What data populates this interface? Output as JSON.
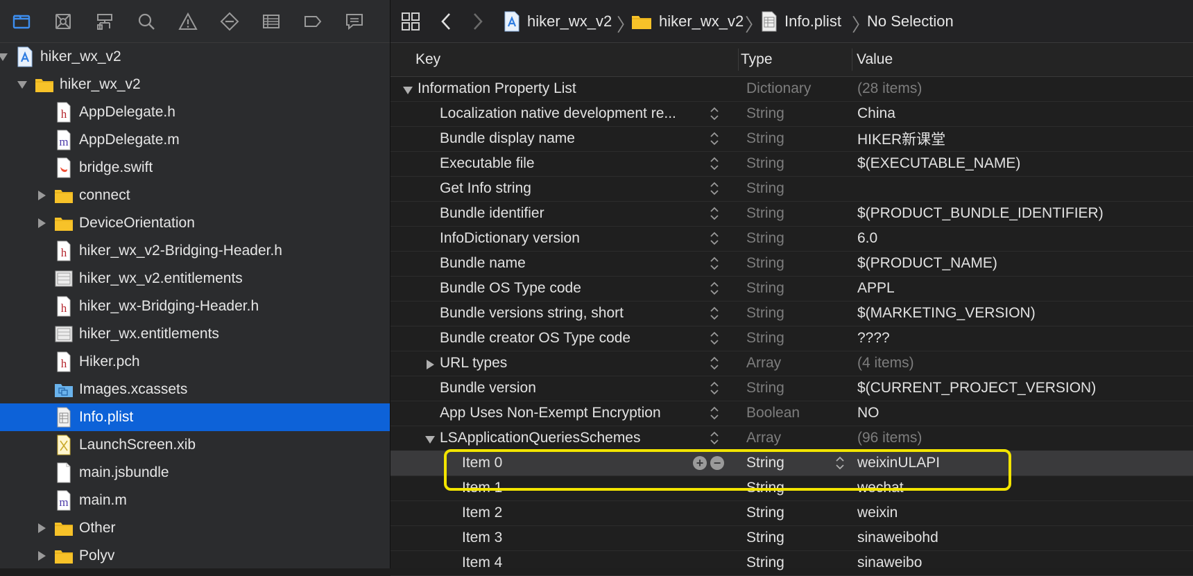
{
  "navigator": {
    "toolbar_icons": [
      "folder-icon",
      "source-control-icon",
      "hierarchy-icon",
      "search-icon",
      "warning-icon",
      "test-icon",
      "debug-icon",
      "breakpoint-icon",
      "report-icon"
    ],
    "items": [
      {
        "label": "hiker_wx_v2",
        "icon": "xcode-project-icon",
        "depth": 0,
        "disclosure": "open"
      },
      {
        "label": "hiker_wx_v2",
        "icon": "folder-icon",
        "depth": 1,
        "disclosure": "open"
      },
      {
        "label": "AppDelegate.h",
        "icon": "header-file-icon",
        "depth": 2
      },
      {
        "label": "AppDelegate.m",
        "icon": "objc-file-icon",
        "depth": 2
      },
      {
        "label": "bridge.swift",
        "icon": "swift-file-icon",
        "depth": 2
      },
      {
        "label": "connect",
        "icon": "folder-icon",
        "depth": 2,
        "disclosure": "closed"
      },
      {
        "label": "DeviceOrientation",
        "icon": "folder-icon",
        "depth": 2,
        "disclosure": "closed"
      },
      {
        "label": "hiker_wx_v2-Bridging-Header.h",
        "icon": "header-file-icon",
        "depth": 2
      },
      {
        "label": "hiker_wx_v2.entitlements",
        "icon": "entitlements-icon",
        "depth": 2
      },
      {
        "label": "hiker_wx-Bridging-Header.h",
        "icon": "header-file-icon",
        "depth": 2
      },
      {
        "label": "hiker_wx.entitlements",
        "icon": "entitlements-icon",
        "depth": 2
      },
      {
        "label": "Hiker.pch",
        "icon": "header-file-icon",
        "depth": 2
      },
      {
        "label": "Images.xcassets",
        "icon": "assets-folder-icon",
        "depth": 2
      },
      {
        "label": "Info.plist",
        "icon": "plist-file-icon",
        "depth": 2,
        "selected": true
      },
      {
        "label": "LaunchScreen.xib",
        "icon": "xib-file-icon",
        "depth": 2
      },
      {
        "label": "main.jsbundle",
        "icon": "blank-file-icon",
        "depth": 2
      },
      {
        "label": "main.m",
        "icon": "objc-file-icon",
        "depth": 2
      },
      {
        "label": "Other",
        "icon": "folder-icon",
        "depth": 2,
        "disclosure": "closed"
      },
      {
        "label": "Polyv",
        "icon": "folder-icon",
        "depth": 2,
        "disclosure": "closed"
      }
    ]
  },
  "jumpbar": {
    "crumbs": [
      "hiker_wx_v2",
      "hiker_wx_v2",
      "Info.plist",
      "No Selection"
    ]
  },
  "plist": {
    "headers": {
      "key": "Key",
      "type": "Type",
      "value": "Value"
    },
    "rows": [
      {
        "key": "Information Property List",
        "type": "Dictionary",
        "value": "(28 items)",
        "level": 0,
        "disclosure": "open",
        "value_dim": true
      },
      {
        "key": "Localization native development re...",
        "type": "String",
        "value": "China",
        "level": 1,
        "stepper": true
      },
      {
        "key": "Bundle display name",
        "type": "String",
        "value": "HIKER新课堂",
        "level": 1,
        "stepper": true
      },
      {
        "key": "Executable file",
        "type": "String",
        "value": "$(EXECUTABLE_NAME)",
        "level": 1,
        "stepper": true
      },
      {
        "key": "Get Info string",
        "type": "String",
        "value": "",
        "level": 1,
        "stepper": true
      },
      {
        "key": "Bundle identifier",
        "type": "String",
        "value": "$(PRODUCT_BUNDLE_IDENTIFIER)",
        "level": 1,
        "stepper": true
      },
      {
        "key": "InfoDictionary version",
        "type": "String",
        "value": "6.0",
        "level": 1,
        "stepper": true
      },
      {
        "key": "Bundle name",
        "type": "String",
        "value": "$(PRODUCT_NAME)",
        "level": 1,
        "stepper": true
      },
      {
        "key": "Bundle OS Type code",
        "type": "String",
        "value": "APPL",
        "level": 1,
        "stepper": true
      },
      {
        "key": "Bundle versions string, short",
        "type": "String",
        "value": "$(MARKETING_VERSION)",
        "level": 1,
        "stepper": true
      },
      {
        "key": "Bundle creator OS Type code",
        "type": "String",
        "value": "????",
        "level": 1,
        "stepper": true
      },
      {
        "key": "URL types",
        "type": "Array",
        "value": "(4 items)",
        "level": 1,
        "disclosure": "closed",
        "stepper": true,
        "value_dim": true
      },
      {
        "key": "Bundle version",
        "type": "String",
        "value": "$(CURRENT_PROJECT_VERSION)",
        "level": 1,
        "stepper": true
      },
      {
        "key": "App Uses Non-Exempt Encryption",
        "type": "Boolean",
        "value": "NO",
        "level": 1,
        "stepper": true
      },
      {
        "key": "LSApplicationQueriesSchemes",
        "type": "Array",
        "value": "(96 items)",
        "level": 1,
        "disclosure": "open",
        "stepper": true,
        "value_dim": true
      },
      {
        "key": "Item 0",
        "type": "String",
        "value": "weixinULAPI",
        "level": 2,
        "selected": true
      },
      {
        "key": "Item 1",
        "type": "String",
        "value": "wechat",
        "level": 2
      },
      {
        "key": "Item 2",
        "type": "String",
        "value": "weixin",
        "level": 2
      },
      {
        "key": "Item 3",
        "type": "String",
        "value": "sinaweibohd",
        "level": 2
      },
      {
        "key": "Item 4",
        "type": "String",
        "value": "sinaweibo",
        "level": 2
      }
    ]
  },
  "colors": {
    "selection": "#0d62d8",
    "highlight": "#f2e400",
    "folder": "#f7c229"
  }
}
